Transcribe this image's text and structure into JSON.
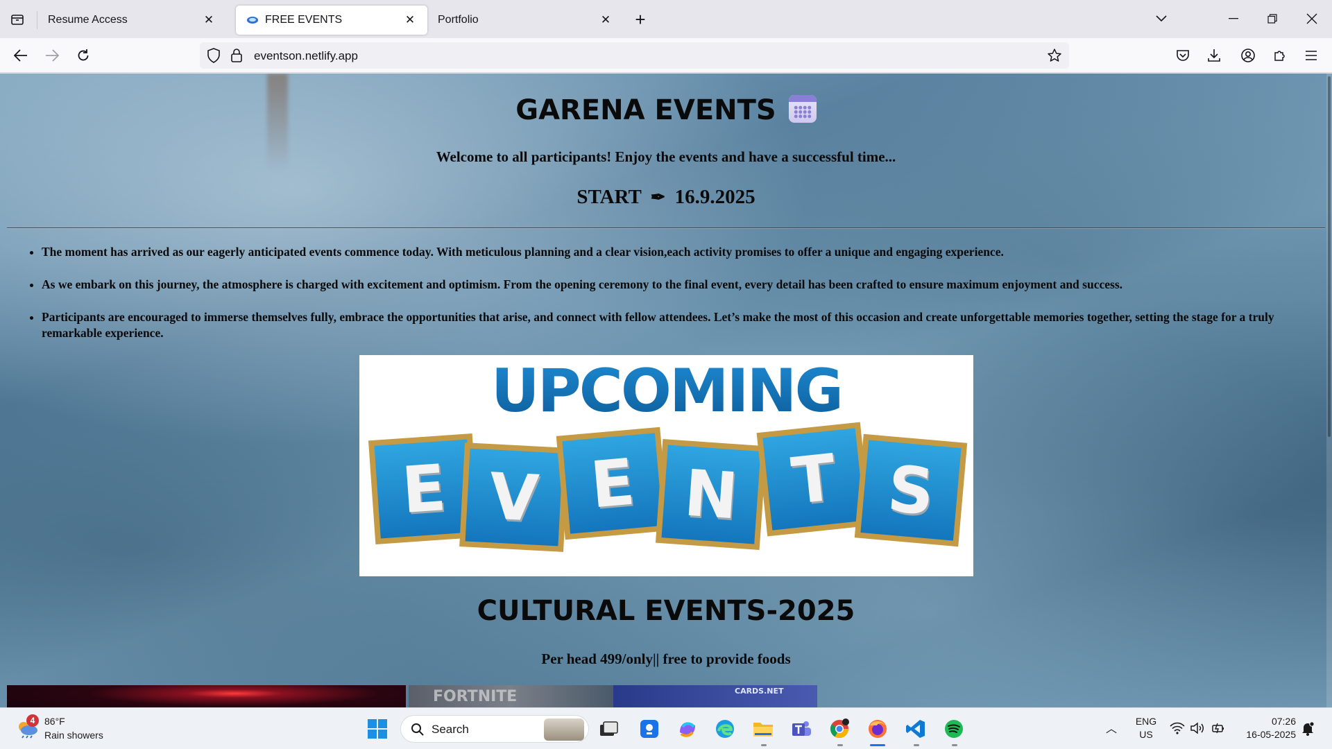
{
  "browser": {
    "tabs": [
      {
        "title": "Resume Access",
        "active": false
      },
      {
        "title": "FREE EVENTS",
        "active": true
      },
      {
        "title": "Portfolio",
        "active": false
      }
    ],
    "url": "eventson.netlify.app"
  },
  "page": {
    "title": "GARENA EVENTS",
    "welcome": "Welcome to all participants! Enjoy the events and have a successful time...",
    "start_label": "START",
    "start_icon": "✒",
    "start_date": "16.9.2025",
    "bullets": [
      "The moment has arrived as our eagerly anticipated events commence today. With meticulous planning and a clear vision,each activity promises to offer a unique and engaging experience.",
      "As we embark on this journey, the atmosphere is charged with excitement and optimism. From the opening ceremony to the final event, every detail has been crafted to ensure maximum enjoyment and success.",
      "Participants are encouraged to immerse themselves fully, embrace the opportunities that arise, and connect with fellow attendees. Let’s make the most of this occasion and create unforgettable memories together, setting the stage for a truly remarkable experience."
    ],
    "banner": {
      "top_word": "UPCOMING",
      "letters": [
        "E",
        "V",
        "E",
        "N",
        "T",
        "S"
      ]
    },
    "section_title": "CULTURAL EVENTS-2025",
    "price": "Per head 499/only|| free to provide foods",
    "thumb2_text": "FORTNITE",
    "thumb3_text": "CARDS.NET"
  },
  "taskbar": {
    "weather_badge": "4",
    "temperature": "86°F",
    "condition": "Rain showers",
    "search_placeholder": "Search",
    "lang_top": "ENG",
    "lang_bottom": "US",
    "time": "07:26",
    "date": "16-05-2025"
  },
  "colors": {
    "accent_blue": "#1476bd",
    "tile_gold": "#c49a45",
    "page_bg": "#6f98b3"
  }
}
